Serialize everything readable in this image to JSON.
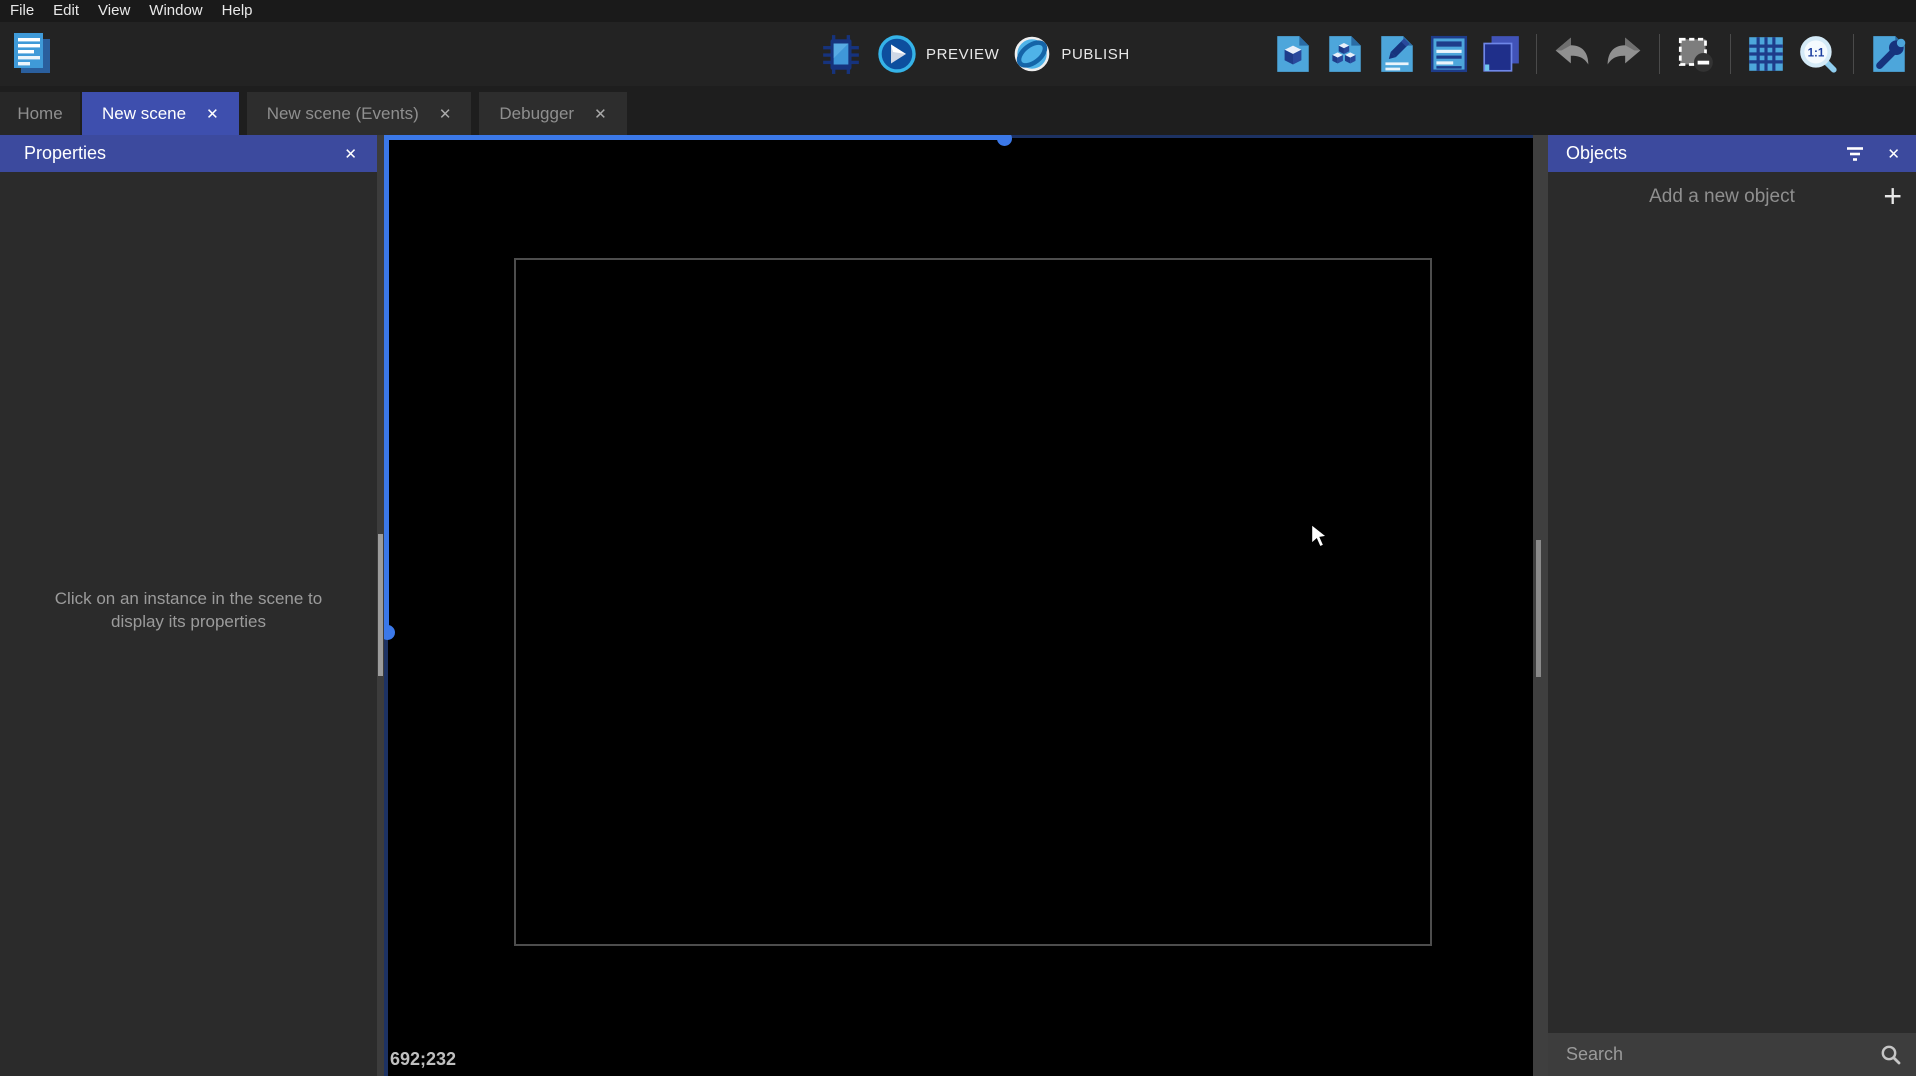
{
  "menu": {
    "items": [
      "File",
      "Edit",
      "View",
      "Window",
      "Help"
    ]
  },
  "toolbar": {
    "preview_label": "PREVIEW",
    "publish_label": "PUBLISH",
    "right_icons": [
      "objects-editor-icon",
      "object-groups-icon",
      "edit-scene-properties-icon",
      "instances-list-icon",
      "layers-icon",
      "undo-icon",
      "redo-icon",
      "mask-icon",
      "grid-icon",
      "zoom-original-icon",
      "extensions-icon"
    ]
  },
  "tabs": [
    {
      "label": "Home",
      "active": false,
      "closable": false
    },
    {
      "label": "New scene",
      "active": true,
      "closable": true
    },
    {
      "label": "New scene (Events)",
      "active": false,
      "closable": true
    },
    {
      "label": "Debugger",
      "active": false,
      "closable": true
    }
  ],
  "properties_panel": {
    "title": "Properties",
    "empty_message": "Click on an instance in the scene to display its properties"
  },
  "objects_panel": {
    "title": "Objects",
    "add_label": "Add a new object",
    "search_placeholder": "Search"
  },
  "canvas": {
    "coordinates": "692;232"
  },
  "icons": {
    "close_glyph": "✕",
    "plus_glyph": "+"
  },
  "colors": {
    "accent_header": "#3c4a9e",
    "active_tab": "#3e4fae",
    "selection_blue": "#3b78e8",
    "selection_dark_blue": "#1d3263",
    "panel_background": "#2b2b2b",
    "canvas_background": "#000000"
  }
}
